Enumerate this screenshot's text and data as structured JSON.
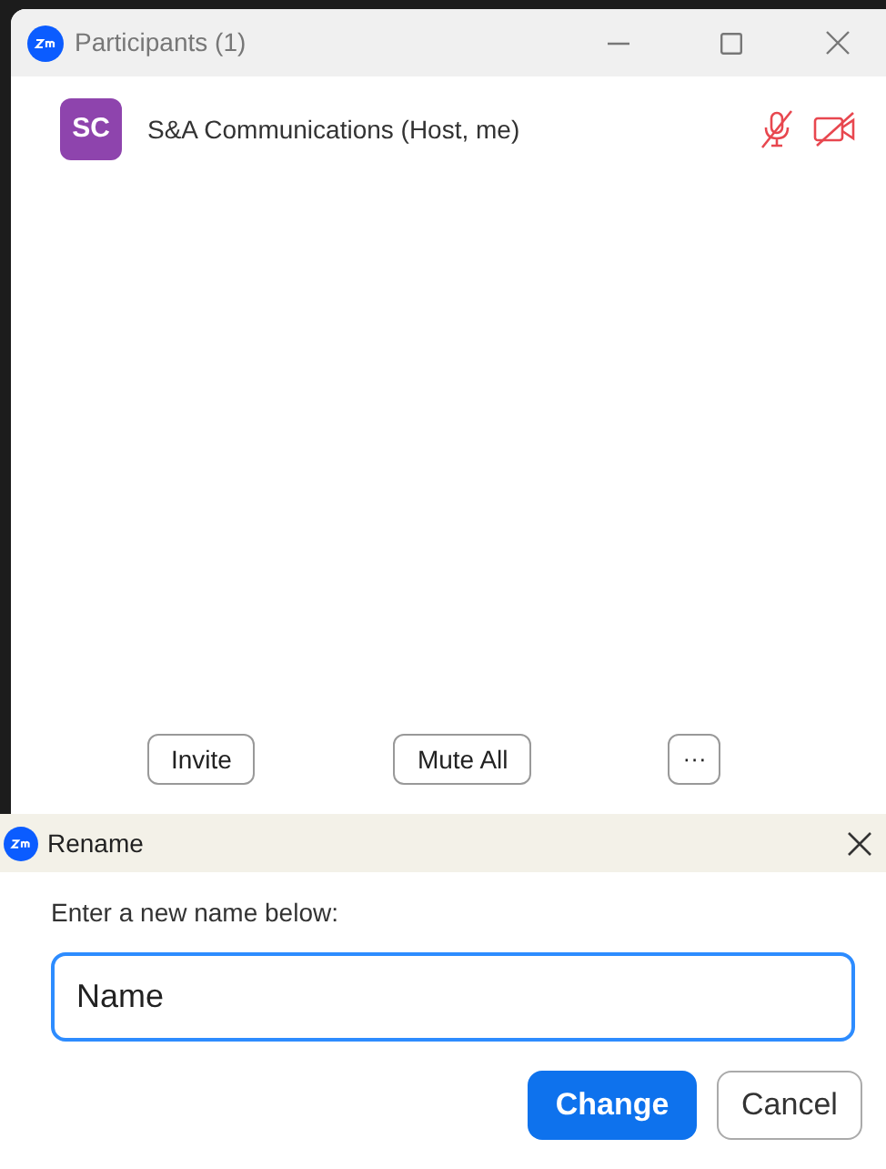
{
  "participants_window": {
    "title": "Participants (1)",
    "participants": [
      {
        "initials": "SC",
        "name": "S&A Communications (Host, me)",
        "color": "#8e44ad",
        "muted": true,
        "video_off": true
      }
    ],
    "buttons": [
      {
        "label": "Invite",
        "kind": "text"
      },
      {
        "label": "Mute All",
        "kind": "text"
      },
      {
        "label": "···",
        "kind": "more"
      }
    ]
  },
  "rename_dialog": {
    "title": "Rename",
    "prompt": "Enter a new name below:",
    "name_field": {
      "value": "Name"
    },
    "buttons": [
      {
        "label": "Change",
        "kind": "primary"
      },
      {
        "label": "Cancel",
        "kind": "secondary"
      }
    ]
  }
}
